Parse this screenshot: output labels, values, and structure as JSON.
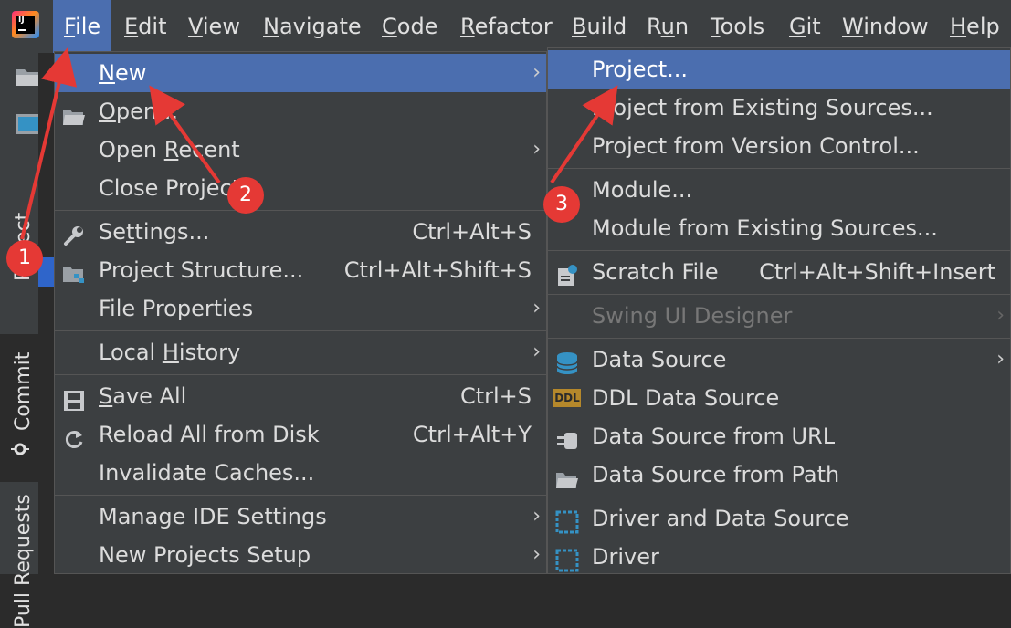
{
  "menubar": {
    "items": [
      {
        "label": "File",
        "mn": "F",
        "rest": "ile"
      },
      {
        "label": "Edit",
        "mn": "E",
        "rest": "dit"
      },
      {
        "label": "View",
        "mn": "V",
        "rest": "iew"
      },
      {
        "label": "Navigate",
        "mn": "N",
        "rest": "avigate"
      },
      {
        "label": "Code",
        "mn": "C",
        "rest": "ode"
      },
      {
        "label": "Refactor",
        "mn": "R",
        "rest": "efactor"
      },
      {
        "label": "Build",
        "mn": "B",
        "rest": "uild"
      },
      {
        "label": "Run",
        "pre": "R",
        "mn": "u",
        "rest": "n"
      },
      {
        "label": "Tools",
        "mn": "T",
        "rest": "ools"
      },
      {
        "label": "Git",
        "mn": "G",
        "rest": "it"
      },
      {
        "label": "Window",
        "mn": "W",
        "rest": "indow"
      },
      {
        "label": "Help",
        "mn": "H",
        "rest": "elp"
      }
    ],
    "logo_text": "IJ"
  },
  "toolstrip": {
    "project": "Project",
    "commit": "Commit",
    "pull_requests": "Pull Requests"
  },
  "file_menu": {
    "new": {
      "mn": "N",
      "rest": "ew"
    },
    "open": {
      "mn": "O",
      "rest": "pen..."
    },
    "open_recent": {
      "pre": "Open ",
      "mn": "R",
      "rest": "ecent"
    },
    "close_project": "Close Project",
    "settings": {
      "pre": "Se",
      "mn": "t",
      "rest": "tings...",
      "shortcut": "Ctrl+Alt+S"
    },
    "project_structure": {
      "label": "Project Structure...",
      "shortcut": "Ctrl+Alt+Shift+S"
    },
    "file_properties": "File Properties",
    "local_history": {
      "pre": "Local ",
      "mn": "H",
      "rest": "istory"
    },
    "save_all": {
      "mn": "S",
      "rest": "ave All",
      "shortcut": "Ctrl+S"
    },
    "reload": {
      "label": "Reload All from Disk",
      "shortcut": "Ctrl+Alt+Y"
    },
    "invalidate": "Invalidate Caches...",
    "manage_ide": "Manage IDE Settings",
    "new_projects_setup": "New Projects Setup"
  },
  "new_submenu": {
    "project": "Project...",
    "project_existing": "Project from Existing Sources...",
    "project_vcs": "Project from Version Control...",
    "module": "Module...",
    "module_existing": "Module from Existing Sources...",
    "scratch": {
      "label": "Scratch File",
      "shortcut": "Ctrl+Alt+Shift+Insert"
    },
    "swing": "Swing UI Designer",
    "data_source": "Data Source",
    "ddl_data_source": "DDL Data Source",
    "ddl_icon_text": "DDL",
    "ds_url": "Data Source from URL",
    "ds_path": "Data Source from Path",
    "driver_ds": "Driver and Data Source",
    "driver": "Driver"
  },
  "annotations": {
    "b1": "1",
    "b2": "2",
    "b3": "3"
  },
  "colors": {
    "selection": "#4b6eaf",
    "menu_bg": "#3c3f41",
    "annotation": "#e53935"
  }
}
